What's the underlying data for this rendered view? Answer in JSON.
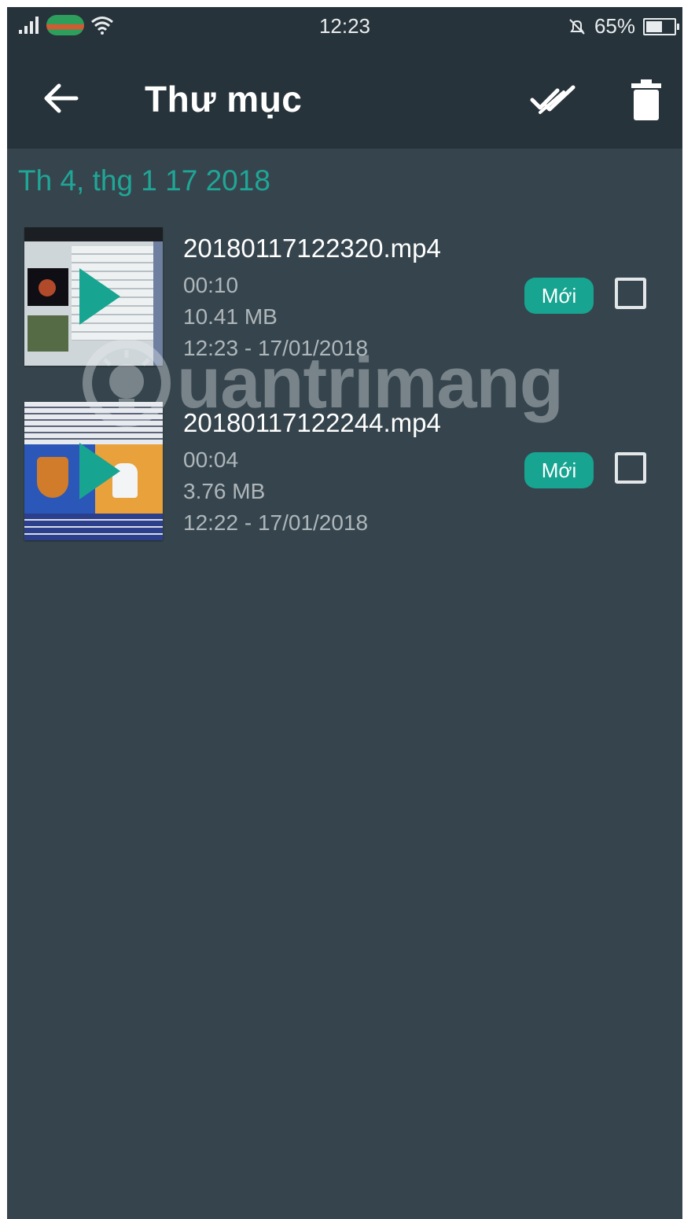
{
  "status_bar": {
    "time": "12:23",
    "battery_percent": "65%",
    "battery_level": 0.65,
    "icons": [
      "signal-icon",
      "carrier-icon",
      "wifi-icon",
      "alarm-off-icon",
      "battery-icon"
    ]
  },
  "toolbar": {
    "title": "Thư mục",
    "icons": [
      "back-arrow-icon",
      "select-all-icon",
      "trash-icon"
    ]
  },
  "date_header": "Th 4, thg 1 17 2018",
  "recordings": [
    {
      "filename": "20180117122320.mp4",
      "duration": "00:10",
      "size": "10.41 MB",
      "datetime": "12:23 - 17/01/2018",
      "badge": "Mới",
      "checked": false
    },
    {
      "filename": "20180117122244.mp4",
      "duration": "00:04",
      "size": "3.76 MB",
      "datetime": "12:22 - 17/01/2018",
      "badge": "Mới",
      "checked": false
    }
  ],
  "watermark": "uantrimang",
  "colors": {
    "accent": "#17a491",
    "background": "#36454d",
    "toolbar": "#27333a"
  }
}
